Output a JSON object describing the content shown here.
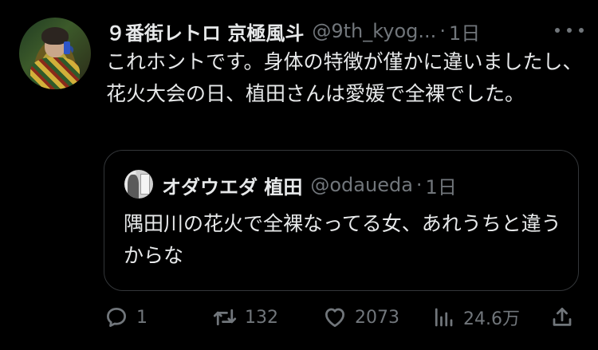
{
  "tweet": {
    "author_name": "９番街レトロ 京極風斗",
    "handle": "@9th_kyog...",
    "separator": "·",
    "time": "1日",
    "text": "これホントです。身体の特徴が僅かに違いましたし、花火大会の日、植田さんは愛媛で全裸でした。"
  },
  "quoted_tweet": {
    "author_name": "オダウエダ 植田",
    "handle": "@odaueda",
    "separator": "·",
    "time": "1日",
    "text": "隅田川の花火で全裸なってる女、あれうちと違うからな"
  },
  "actions": {
    "reply_count": "1",
    "retweet_count": "132",
    "like_count": "2073",
    "views_count": "24.6万"
  },
  "icons": {
    "more": "more-dots-icon",
    "reply": "reply-bubble-icon",
    "retweet": "retweet-arrows-icon",
    "like": "heart-icon",
    "views": "views-bars-icon",
    "share": "share-upload-icon"
  },
  "colors": {
    "background": "#000000",
    "text": "#e7e9ea",
    "secondary": "#71767b",
    "border": "#333639"
  }
}
